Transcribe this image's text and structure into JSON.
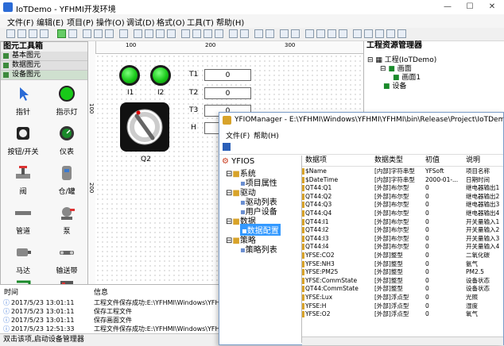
{
  "window": {
    "title": "IoTDemo - YFHMI开发环境",
    "min": "—",
    "max": "☐",
    "close": "✕"
  },
  "menu": [
    "文件(F)",
    "编辑(E)",
    "项目(P)",
    "操作(O)",
    "调试(D)",
    "格式(O)",
    "工具(T)",
    "帮助(H)"
  ],
  "toolbox": {
    "title": "图元工具箱",
    "groups": [
      "基本图元",
      "数据图元",
      "设备图元"
    ],
    "tools": [
      "指针",
      "指示灯",
      "按钮/开关",
      "仪表",
      "阀",
      "仓/罐",
      "管道",
      "泵",
      "马达",
      "输送带",
      "",
      ""
    ]
  },
  "canvas": {
    "labels": {
      "i1": "I1",
      "i2": "I2",
      "q2": "Q2",
      "t1": "T1",
      "t2": "T2",
      "t3": "T3",
      "h": "H"
    },
    "values": {
      "t1": "0",
      "t2": "0",
      "t3": "0",
      "h": "0"
    },
    "ruler_top": [
      "100",
      "200",
      "300"
    ],
    "ruler_left": [
      "100",
      "200"
    ]
  },
  "resource_manager": {
    "title": "工程资源管理器",
    "root": "工程(IoTDemo)",
    "screens": "画面",
    "screen1": "画面1",
    "devices": "设备"
  },
  "log": {
    "headers": [
      "时间",
      "信息"
    ],
    "rows": [
      {
        "time": "2017/5/23 13:01:11",
        "msg": "工程文件保存成功:E:\\YFHMI\\Windows\\YFHMI\\"
      },
      {
        "time": "2017/5/23 13:01:11",
        "msg": "保存工程文件"
      },
      {
        "time": "2017/5/23 13:01:11",
        "msg": "保存画面文件"
      },
      {
        "time": "2017/5/23 12:51:33",
        "msg": "工程文件保存成功:E:\\YFHMI\\Windows\\YFHMI\\"
      }
    ]
  },
  "status": "双击该项,启动设备管理器",
  "iof": {
    "title": "YFIOManager - E:\\YFHMI\\Windows\\YFHMI\\YFHMI\\bin\\Release\\Project\\IoTDemo\\ioConfig.ios",
    "menu": [
      "文件(F)",
      "帮助(H)"
    ],
    "tree": {
      "root": "YFIOS",
      "system": "系统",
      "proj_attr": "项目属性",
      "driver": "驱动",
      "driver_list": "驱动列表",
      "user_dev": "用户设备",
      "data": "数据",
      "data_config": "数据配置",
      "strategy": "策略",
      "strategy_list": "策略列表"
    },
    "headers": [
      "数据项",
      "数据类型",
      "初值",
      "说明"
    ],
    "rows": [
      [
        "$Name",
        "[内部]字符串型",
        "YFSoft",
        "项目名称"
      ],
      [
        "$DateTime",
        "[内部]字符串型",
        "2000-01-...",
        "日期时间"
      ],
      [
        "QT44:Q1",
        "[外部]布尔型",
        "0",
        "继电器输出1"
      ],
      [
        "QT44:Q2",
        "[外部]布尔型",
        "0",
        "继电器输出2"
      ],
      [
        "QT44:Q3",
        "[外部]布尔型",
        "0",
        "继电器输出3"
      ],
      [
        "QT44:Q4",
        "[外部]布尔型",
        "0",
        "继电器输出4"
      ],
      [
        "QT44:I1",
        "[外部]布尔型",
        "0",
        "开关量输入1"
      ],
      [
        "QT44:I2",
        "[外部]布尔型",
        "0",
        "开关量输入2"
      ],
      [
        "QT44:I3",
        "[外部]布尔型",
        "0",
        "开关量输入3"
      ],
      [
        "QT44:I4",
        "[外部]布尔型",
        "0",
        "开关量输入4"
      ],
      [
        "YFSE:CO2",
        "[外部]整型",
        "0",
        "二氧化碳"
      ],
      [
        "YFSE:NH3",
        "[外部]整型",
        "0",
        "氨气"
      ],
      [
        "YFSE:PM25",
        "[外部]整型",
        "0",
        "PM2.5"
      ],
      [
        "YFSE:CommState",
        "[外部]整型",
        "0",
        "设备状态"
      ],
      [
        "QT44:CommState",
        "[外部]整型",
        "0",
        "设备状态"
      ],
      [
        "YFSE:Lux",
        "[外部]浮点型",
        "0",
        "光照"
      ],
      [
        "YFSE:H",
        "[外部]浮点型",
        "0",
        "湿度"
      ],
      [
        "YFSE:O2",
        "[外部]浮点型",
        "0",
        "氧气"
      ]
    ]
  },
  "colors": {
    "led": "#19c919",
    "accent": "#2b6bd6",
    "selection": "#3399ff"
  }
}
